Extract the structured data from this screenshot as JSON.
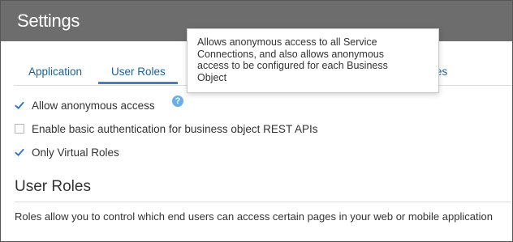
{
  "header": {
    "title": "Settings"
  },
  "tabs": [
    {
      "label": "Application"
    },
    {
      "label": "User Roles",
      "active": true
    },
    {
      "label": "es"
    }
  ],
  "checkboxes": [
    {
      "label": "Allow anonymous access",
      "checked": true
    },
    {
      "label": "Enable basic authentication for business object REST APIs",
      "checked": false
    },
    {
      "label": "Only Virtual Roles",
      "checked": true
    }
  ],
  "help": {
    "icon": "help-icon",
    "glyph": "?"
  },
  "tooltip": {
    "text": "Allows anonymous access to all Service Connections, and also allows anonymous access to be configured for each Business Object"
  },
  "section": {
    "title": "User Roles",
    "description": "Roles allow you to control which end users can access certain pages in your web or mobile application"
  },
  "colors": {
    "header_bg": "#6d6d6d",
    "tab_text": "#1f5f99",
    "tab_active_underline": "#3f7fcf",
    "checkmark": "#2d6fc2",
    "help_icon": "#69aee6"
  }
}
